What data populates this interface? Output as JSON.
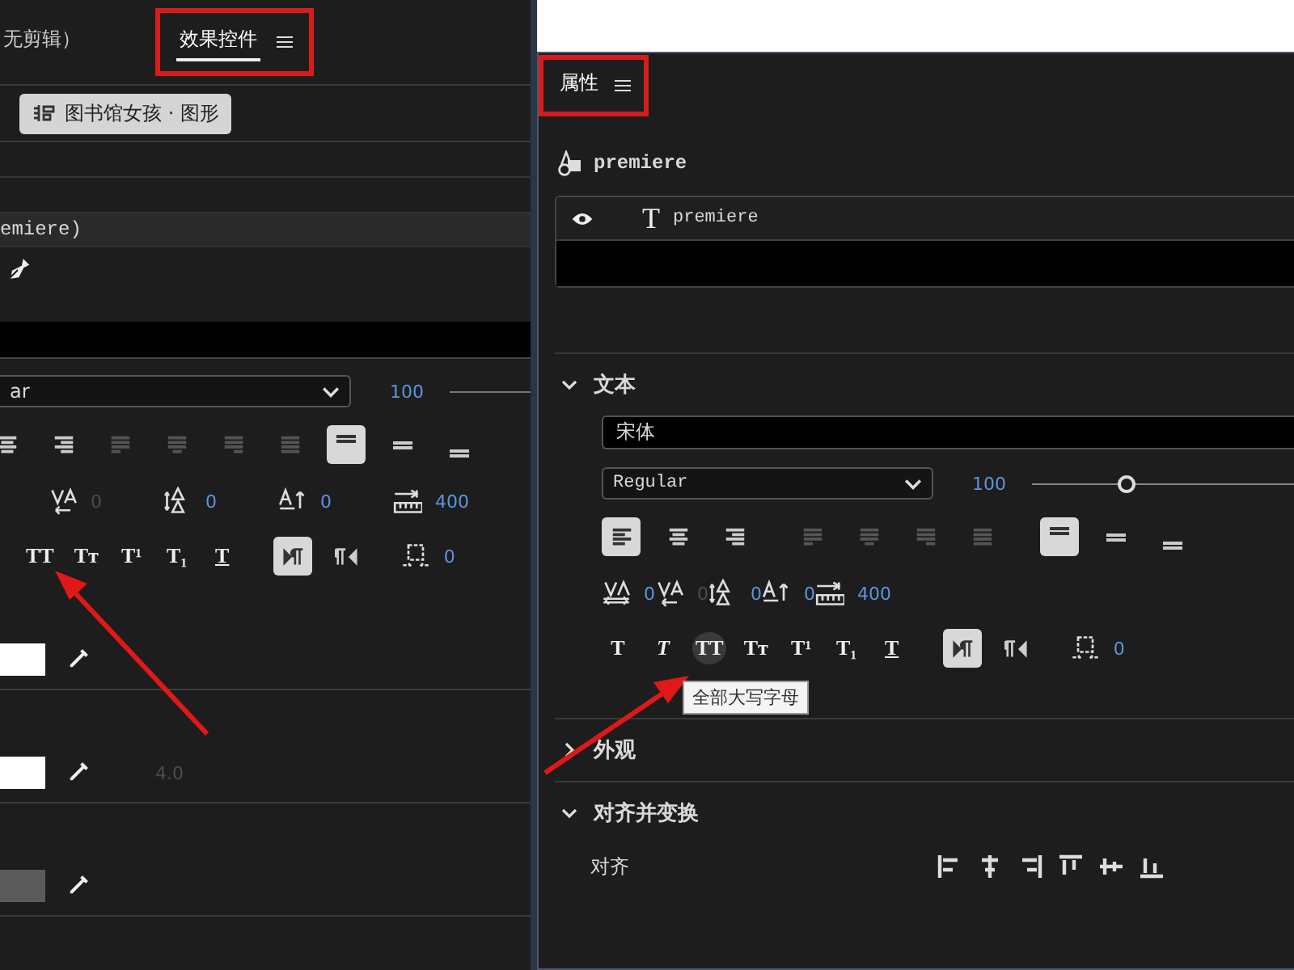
{
  "left_panel": {
    "tabs": [
      {
        "label": "无剪辑）",
        "selected": false,
        "highlighted": false
      },
      {
        "label": "效果控件",
        "selected": true,
        "highlighted": true
      }
    ],
    "clip_chip": "图书馆女孩 · 图形",
    "layer_name": "emiere)",
    "font_style": "ar",
    "font_size": "100",
    "align_buttons": [
      {
        "kind": "center",
        "selected": false,
        "disabled": false
      },
      {
        "kind": "right",
        "selected": false,
        "disabled": false
      },
      {
        "kind": "justify_left",
        "selected": false,
        "disabled": true
      },
      {
        "kind": "justify_center",
        "selected": false,
        "disabled": true
      },
      {
        "kind": "justify_right",
        "selected": false,
        "disabled": true
      },
      {
        "kind": "justify_all",
        "selected": false,
        "disabled": true
      },
      {
        "kind": "top",
        "selected": true,
        "disabled": false
      },
      {
        "kind": "middle",
        "selected": false,
        "disabled": false
      },
      {
        "kind": "bottom",
        "selected": false,
        "disabled": false
      }
    ],
    "metrics": [
      {
        "kind": "tracking",
        "value": "0",
        "disabled": true
      },
      {
        "kind": "leading",
        "value": "0",
        "disabled": false
      },
      {
        "kind": "baseline",
        "value": "0",
        "disabled": false
      },
      {
        "kind": "tab_width",
        "value": "400",
        "disabled": false
      }
    ],
    "style_buttons": [
      {
        "kind": "all_caps",
        "label": "TT",
        "hovered": false
      },
      {
        "kind": "small_caps",
        "label": "Tᴛ",
        "hovered": false
      },
      {
        "kind": "superscript",
        "label": "T¹",
        "hovered": false
      },
      {
        "kind": "subscript",
        "label": "T₁",
        "hovered": false
      },
      {
        "kind": "underline",
        "label": "T",
        "hovered": false
      }
    ],
    "direction_buttons": [
      {
        "kind": "ltr",
        "selected": true
      },
      {
        "kind": "rtl",
        "selected": false
      }
    ],
    "tsume": "0",
    "color_rows": [
      {
        "color": "#ffffff"
      },
      {
        "color": "#ffffff",
        "value": "4.0"
      },
      {
        "color": "#5a5a5a"
      }
    ]
  },
  "right_panel": {
    "tab": {
      "label": "属性",
      "highlighted": true
    },
    "graphic_name": "premiere",
    "layers": [
      {
        "glyph": "T",
        "name": "premiere"
      }
    ],
    "text_section": {
      "title": "文本",
      "expanded": true,
      "font": "宋体",
      "font_style": "Regular",
      "font_size": "100",
      "level": 0.36,
      "align_buttons": [
        {
          "kind": "left",
          "selected": true,
          "disabled": false
        },
        {
          "kind": "center",
          "selected": false,
          "disabled": false
        },
        {
          "kind": "right",
          "selected": false,
          "disabled": false
        },
        {
          "kind": "justify_left",
          "selected": false,
          "disabled": true
        },
        {
          "kind": "justify_center",
          "selected": false,
          "disabled": true
        },
        {
          "kind": "justify_right",
          "selected": false,
          "disabled": true
        },
        {
          "kind": "justify_all",
          "selected": false,
          "disabled": true
        },
        {
          "kind": "top",
          "selected": true,
          "disabled": false
        },
        {
          "kind": "middle",
          "selected": false,
          "disabled": false
        },
        {
          "kind": "bottom",
          "selected": false,
          "disabled": false
        }
      ],
      "metrics": [
        {
          "kind": "kerning",
          "value": "0",
          "disabled": false
        },
        {
          "kind": "tracking",
          "value": "0",
          "disabled": true
        },
        {
          "kind": "leading",
          "value": "0",
          "disabled": false
        },
        {
          "kind": "baseline",
          "value": "0",
          "disabled": false
        },
        {
          "kind": "tab_width",
          "value": "400",
          "disabled": false
        }
      ],
      "style_buttons": [
        {
          "kind": "bold",
          "label": "T",
          "hovered": false
        },
        {
          "kind": "italic",
          "label": "T",
          "hovered": false
        },
        {
          "kind": "all_caps",
          "label": "TT",
          "hovered": true
        },
        {
          "kind": "small_caps",
          "label": "Tᴛ",
          "hovered": false
        },
        {
          "kind": "superscript",
          "label": "T¹",
          "hovered": false
        },
        {
          "kind": "subscript",
          "label": "T₁",
          "hovered": false
        },
        {
          "kind": "underline",
          "label": "T",
          "hovered": false
        }
      ],
      "tooltip": "全部大写字母",
      "direction_buttons": [
        {
          "kind": "ltr",
          "selected": true
        },
        {
          "kind": "rtl",
          "selected": false
        }
      ],
      "tsume": "0"
    },
    "appearance_section": {
      "title": "外观",
      "expanded": false
    },
    "align_section": {
      "title": "对齐并变换",
      "expanded": true,
      "label": "对齐",
      "buttons": [
        {
          "kind": "align_left"
        },
        {
          "kind": "align_h_center"
        },
        {
          "kind": "align_right"
        },
        {
          "kind": "align_top"
        },
        {
          "kind": "align_v_center"
        },
        {
          "kind": "align_bottom"
        }
      ]
    }
  }
}
